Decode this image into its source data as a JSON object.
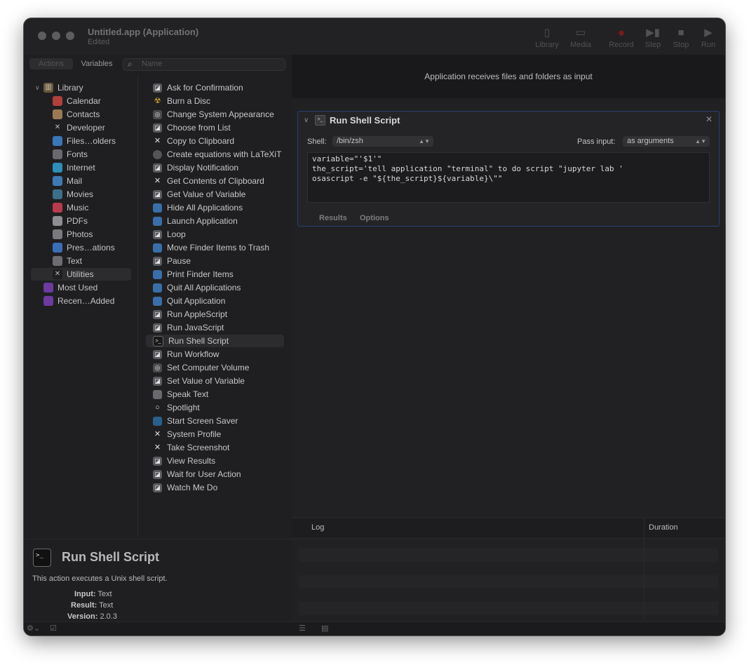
{
  "window": {
    "title": "Untitled.app (Application)",
    "subtitle": "Edited"
  },
  "toolbar": {
    "library": "Library",
    "media": "Media",
    "record": "Record",
    "step": "Step",
    "stop": "Stop",
    "run": "Run"
  },
  "sidebar": {
    "tab_actions": "Actions",
    "tab_variables": "Variables",
    "search_placeholder": "Name",
    "library_label": "Library",
    "categories": [
      {
        "label": "Calendar",
        "icon": "calendar-icon",
        "color": "#b0403c"
      },
      {
        "label": "Contacts",
        "icon": "contacts-icon",
        "color": "#9a7a55"
      },
      {
        "label": "Developer",
        "icon": "developer-icon",
        "color": "#1f1f21"
      },
      {
        "label": "Files…olders",
        "icon": "finder-icon",
        "color": "#3a76b8"
      },
      {
        "label": "Fonts",
        "icon": "fonts-icon",
        "color": "#6a6a6e"
      },
      {
        "label": "Internet",
        "icon": "internet-icon",
        "color": "#2e8fb8"
      },
      {
        "label": "Mail",
        "icon": "mail-icon",
        "color": "#3e79b5"
      },
      {
        "label": "Movies",
        "icon": "movies-icon",
        "color": "#3d6e8a"
      },
      {
        "label": "Music",
        "icon": "music-icon",
        "color": "#b83a4d"
      },
      {
        "label": "PDFs",
        "icon": "pdf-icon",
        "color": "#8e8e92"
      },
      {
        "label": "Photos",
        "icon": "photos-icon",
        "color": "#7a7a7e"
      },
      {
        "label": "Pres…ations",
        "icon": "presentations-icon",
        "color": "#3a6fb8"
      },
      {
        "label": "Text",
        "icon": "text-icon",
        "color": "#6d6d71"
      },
      {
        "label": "Utilities",
        "icon": "utilities-icon",
        "color": "#1f1f21"
      }
    ],
    "most_used": "Most Used",
    "recently_added": "Recen…Added"
  },
  "actions": [
    {
      "label": "Ask for Confirmation",
      "icon": "automator-icon"
    },
    {
      "label": "Burn a Disc",
      "icon": "burn-icon"
    },
    {
      "label": "Change System Appearance",
      "icon": "gear-icon"
    },
    {
      "label": "Choose from List",
      "icon": "automator-icon"
    },
    {
      "label": "Copy to Clipboard",
      "icon": "tools-icon"
    },
    {
      "label": "Create equations with LaTeXiT",
      "icon": "latexit-icon"
    },
    {
      "label": "Display Notification",
      "icon": "automator-icon"
    },
    {
      "label": "Get Contents of Clipboard",
      "icon": "tools-icon"
    },
    {
      "label": "Get Value of Variable",
      "icon": "automator-icon"
    },
    {
      "label": "Hide All Applications",
      "icon": "finder-icon"
    },
    {
      "label": "Launch Application",
      "icon": "finder-icon"
    },
    {
      "label": "Loop",
      "icon": "automator-icon"
    },
    {
      "label": "Move Finder Items to Trash",
      "icon": "finder-icon"
    },
    {
      "label": "Pause",
      "icon": "automator-icon"
    },
    {
      "label": "Print Finder Items",
      "icon": "finder-icon"
    },
    {
      "label": "Quit All Applications",
      "icon": "finder-icon"
    },
    {
      "label": "Quit Application",
      "icon": "finder-icon"
    },
    {
      "label": "Run AppleScript",
      "icon": "automator-icon"
    },
    {
      "label": "Run JavaScript",
      "icon": "automator-icon"
    },
    {
      "label": "Run Shell Script",
      "icon": "terminal-icon"
    },
    {
      "label": "Run Workflow",
      "icon": "automator-icon"
    },
    {
      "label": "Set Computer Volume",
      "icon": "gear-icon"
    },
    {
      "label": "Set Value of Variable",
      "icon": "automator-icon"
    },
    {
      "label": "Speak Text",
      "icon": "text-icon"
    },
    {
      "label": "Spotlight",
      "icon": "spotlight-icon"
    },
    {
      "label": "Start Screen Saver",
      "icon": "screensaver-icon"
    },
    {
      "label": "System Profile",
      "icon": "tools-icon"
    },
    {
      "label": "Take Screenshot",
      "icon": "tools-icon"
    },
    {
      "label": "View Results",
      "icon": "automator-icon"
    },
    {
      "label": "Wait for User Action",
      "icon": "automator-icon"
    },
    {
      "label": "Watch Me Do",
      "icon": "automator-icon"
    }
  ],
  "workflow": {
    "banner": "Application receives files and folders as input",
    "card": {
      "title": "Run Shell Script",
      "shell_label": "Shell:",
      "shell_value": "/bin/zsh",
      "pass_input_label": "Pass input:",
      "pass_input_value": "as arguments",
      "script": "variable=\"'$1'\"\nthe_script='tell application \"terminal\" to do script \"jupyter lab '\nosascript -e \"${the_script}${variable}\\\"\"",
      "tab_results": "Results",
      "tab_options": "Options"
    }
  },
  "log": {
    "col_log": "Log",
    "col_duration": "Duration"
  },
  "description": {
    "title": "Run Shell Script",
    "text": "This action executes a Unix shell script.",
    "input_label": "Input:",
    "input_value": "Text",
    "result_label": "Result:",
    "result_value": "Text",
    "version_label": "Version:",
    "version_value": "2.0.3"
  }
}
